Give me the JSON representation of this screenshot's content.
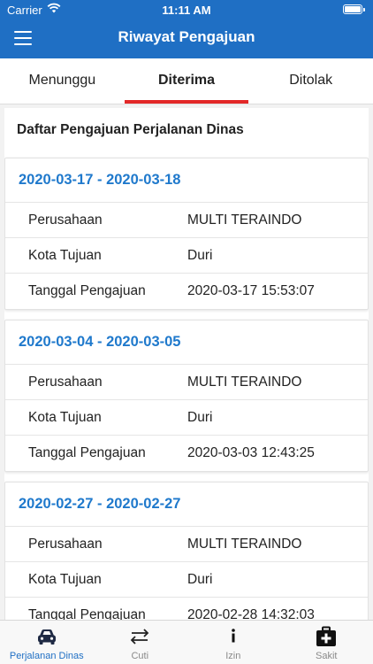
{
  "status_bar": {
    "carrier": "Carrier",
    "time": "11:11 AM"
  },
  "header": {
    "title": "Riwayat Pengajuan"
  },
  "tabs": [
    {
      "label": "Menunggu",
      "active": false
    },
    {
      "label": "Diterima",
      "active": true
    },
    {
      "label": "Ditolak",
      "active": false
    }
  ],
  "list": {
    "title": "Daftar Pengajuan Perjalanan Dinas",
    "field_labels": {
      "company": "Perusahaan",
      "city": "Kota Tujuan",
      "date": "Tanggal Pengajuan"
    },
    "cards": [
      {
        "range": "2020-03-17 - 2020-03-18",
        "company": "MULTI TERAINDO",
        "city": "Duri",
        "submitted": "2020-03-17 15:53:07"
      },
      {
        "range": "2020-03-04 - 2020-03-05",
        "company": "MULTI TERAINDO",
        "city": "Duri",
        "submitted": "2020-03-03 12:43:25"
      },
      {
        "range": "2020-02-27 - 2020-02-27",
        "company": "MULTI TERAINDO",
        "city": "Duri",
        "submitted": "2020-02-28 14:32:03"
      }
    ]
  },
  "bottom_nav": [
    {
      "label": "Perjalanan Dinas",
      "icon": "car-icon",
      "active": true
    },
    {
      "label": "Cuti",
      "icon": "swap-arrows-icon",
      "active": false
    },
    {
      "label": "Izin",
      "icon": "info-icon",
      "active": false
    },
    {
      "label": "Sakit",
      "icon": "medical-kit-icon",
      "active": false
    }
  ],
  "colors": {
    "primary": "#1f6fc4",
    "tab_indicator": "#e32828",
    "date_range_text": "#1f79cc"
  }
}
